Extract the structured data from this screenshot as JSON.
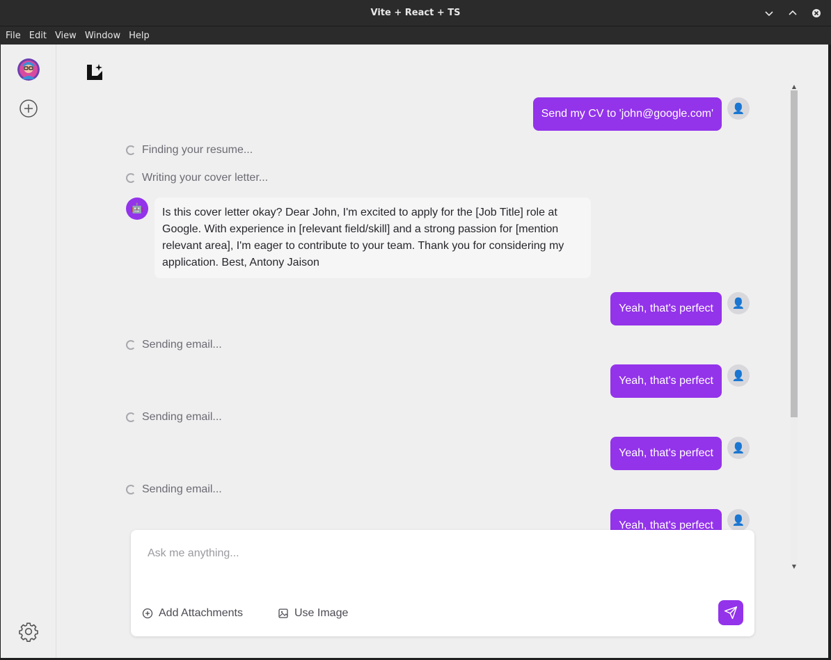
{
  "window": {
    "title": "Vite + React + TS"
  },
  "menu": [
    "File",
    "Edit",
    "View",
    "Window",
    "Help"
  ],
  "chat": {
    "first_request": "Send my CV to 'john@google.com'",
    "status_finding": "Finding your resume...",
    "status_writing": "Writing your cover letter...",
    "bot_reply": "Is this cover letter okay? Dear John, I'm excited to apply for the [Job Title] role at Google. With experience in [relevant field/skill] and a strong passion for [mention relevant area], I'm eager to contribute to your team. Thank you for considering my application. Best, Antony Jaison",
    "confirm": "Yeah, that's perfect",
    "status_sending": "Sending email..."
  },
  "composer": {
    "placeholder": "Ask me anything...",
    "add_attachments": "Add Attachments",
    "use_image": "Use Image"
  },
  "colors": {
    "accent": "#9333ea",
    "background": "#efeff0",
    "bot_bubble": "#f6f6f7"
  },
  "icons": {
    "user": "user-icon",
    "bot": "robot-icon",
    "send": "send-icon",
    "settings": "gear-icon",
    "new_chat": "plus-circle-icon"
  }
}
